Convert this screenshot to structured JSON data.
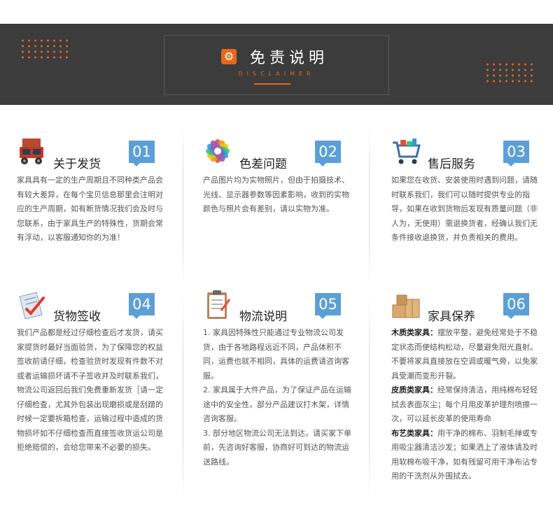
{
  "header": {
    "title": "免责说明",
    "subtitle": "DISCLAIMER",
    "icon": "gear-icon",
    "accent_color": "#e8671c",
    "badge_color": "#5c9fd8"
  },
  "sections": [
    {
      "number": "01",
      "title": "关于发货",
      "icon": "truck-icon",
      "text": "家具具有一定的生产周期且不同种类产品会有较大差异，在每个宝贝信息那里会注明对应的生产周期，如有断货情况我们会及时与您联系，由于家具生产的特殊性，货期会常有浮动，以客服通知你的为准！"
    },
    {
      "number": "02",
      "title": "色差问题",
      "icon": "color-wheel-icon",
      "text": "产品图片均为实物照片，但由于拍摄技术、光线、显示器参数等因素影响，收到的实物颜色与照片会有差别，请以实物为准。"
    },
    {
      "number": "03",
      "title": "售后服务",
      "icon": "shopping-cart-icon",
      "text": "如果您在收货、安装使用时遇到问题，请随时联系我们，我们可以随时提供专业的指导，如果在收到货物后发现有质量问题（非人为，无使用）需退换货者，经确认我们无条件接收退换货，并负责相关的费用。"
    },
    {
      "number": "04",
      "title": "货物签收",
      "icon": "checklist-icon",
      "text": "我们产品都是经过仔细检查后才发货，请买家提货时最好当面验货，为了保障您的权益签收前请仔细，检查验货时发现有件数不对或者运输损坏请不子签收并及时联系我们，物流公司返回后我们免费重新发货［请一定仔细检查，尤其外包装出现磨损或是刮蹭的时候一定要拆箱检查，运输过程中造成的货物损坏如不仔细检查而直接签收货运公司是拒绝赔偿的，会给您带来不必要的损失。"
    },
    {
      "number": "05",
      "title": "物流说明",
      "icon": "clipboard-icon",
      "paragraphs": [
        "1. 家具因特殊性只能通过专业物流公司发货，由于各地路程远近不同，产品体积不同，运费也就不相同，具体的运费请咨询客服。",
        "2. 家具属于大件产品，为了保证产品在运输途中的安全性，部分产品建议打木架，详情咨询客服。",
        "3. 部分地区物流公司无法到达，请买家下单前，先咨询好客服，协商好可到达的物流运送路线。"
      ]
    },
    {
      "number": "06",
      "title": "家具保养",
      "icon": "boxes-icon",
      "care": [
        {
          "label": "木质类家具：",
          "text": "摆放平整，避免经常处于不稳定状态而使结构松动，尽量避免阳光直射。不要将家具直接放在空调或暖气旁，以免家具受潮而变形开裂。"
        },
        {
          "label": "皮质类家具：",
          "text": "经常保持清洁，用纯棉布轻轻拭去表面灰尘；每个月用皮革护理剂喷擦一次，可以延长皮革的使用寿命"
        },
        {
          "label": "布艺类家具：",
          "text": "用干净的棉布、羽制毛掸或专用吸尘器清洁沙发；如果洒上了液体请及时用软棉布吸干净，如有残留可用干净布沾专用的干洗剂从外围拭去。"
        }
      ]
    }
  ]
}
